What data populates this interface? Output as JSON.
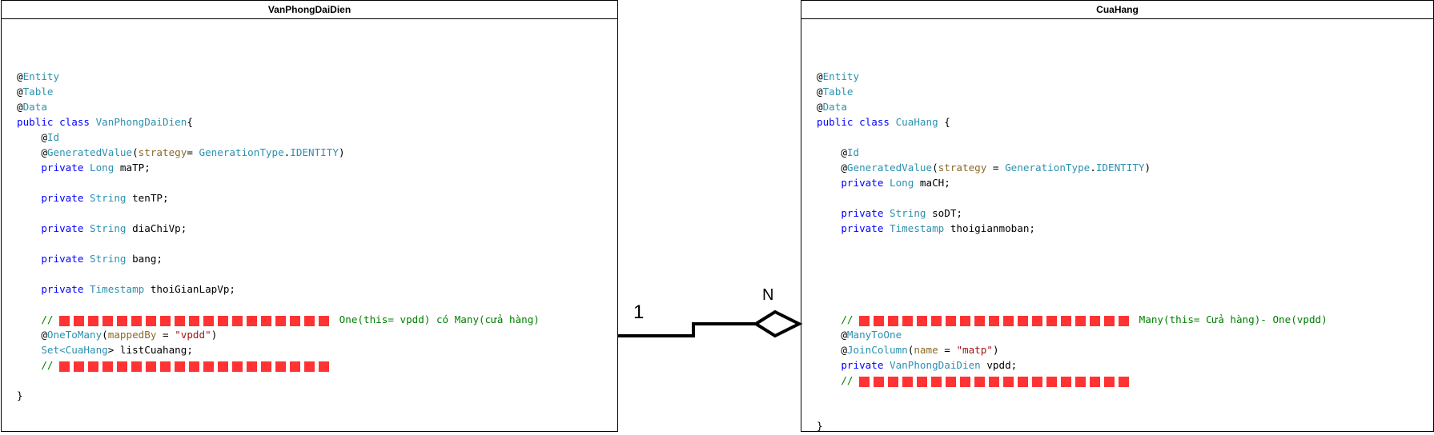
{
  "diagram": {
    "left_class": {
      "title": "VanPhongDaiDien",
      "code": [
        [],
        [
          {
            "t": "@",
            "c": "at"
          },
          {
            "t": "Entity",
            "c": "ann"
          }
        ],
        [
          {
            "t": "@",
            "c": "at"
          },
          {
            "t": "Table",
            "c": "ann"
          }
        ],
        [
          {
            "t": "@",
            "c": "at"
          },
          {
            "t": "Data",
            "c": "ann"
          }
        ],
        [
          {
            "t": "public class ",
            "c": "kw"
          },
          {
            "t": "VanPhongDaiDien",
            "c": "type"
          },
          {
            "t": "{",
            "c": "plain"
          }
        ],
        [
          {
            "t": "    @",
            "c": "at"
          },
          {
            "t": "Id",
            "c": "ann"
          }
        ],
        [
          {
            "t": "    @",
            "c": "at"
          },
          {
            "t": "GeneratedValue",
            "c": "ann"
          },
          {
            "t": "(",
            "c": "plain"
          },
          {
            "t": "strategy",
            "c": "param"
          },
          {
            "t": "= ",
            "c": "plain"
          },
          {
            "t": "GenerationType",
            "c": "type"
          },
          {
            "t": ".",
            "c": "plain"
          },
          {
            "t": "IDENTITY",
            "c": "ann"
          },
          {
            "t": ")",
            "c": "plain"
          }
        ],
        [
          {
            "t": "    private ",
            "c": "kw"
          },
          {
            "t": "Long ",
            "c": "type"
          },
          {
            "t": "maTP;",
            "c": "plain"
          }
        ],
        [],
        [
          {
            "t": "    private ",
            "c": "kw"
          },
          {
            "t": "String ",
            "c": "type"
          },
          {
            "t": "tenTP;",
            "c": "plain"
          }
        ],
        [],
        [
          {
            "t": "    private ",
            "c": "kw"
          },
          {
            "t": "String ",
            "c": "type"
          },
          {
            "t": "diaChiVp;",
            "c": "plain"
          }
        ],
        [],
        [
          {
            "t": "    private ",
            "c": "kw"
          },
          {
            "t": "String ",
            "c": "type"
          },
          {
            "t": "bang;",
            "c": "plain"
          }
        ],
        [],
        [
          {
            "t": "    private ",
            "c": "kw"
          },
          {
            "t": "Timestamp ",
            "c": "type"
          },
          {
            "t": "thoiGianLapVp;",
            "c": "plain"
          }
        ],
        [],
        [
          {
            "t": "    // ",
            "c": "cmt"
          },
          {
            "bar": 19
          },
          {
            "t": " One(this= vpdd) có Many(cửa hàng)",
            "c": "cmt"
          }
        ],
        [
          {
            "t": "    @",
            "c": "at"
          },
          {
            "t": "OneToMany",
            "c": "ann"
          },
          {
            "t": "(",
            "c": "plain"
          },
          {
            "t": "mappedBy",
            "c": "param"
          },
          {
            "t": " = ",
            "c": "plain"
          },
          {
            "t": "\"vpdd\"",
            "c": "str"
          },
          {
            "t": ")",
            "c": "plain"
          }
        ],
        [
          {
            "t": "    Set<",
            "c": "type"
          },
          {
            "t": "CuaHang",
            "c": "type"
          },
          {
            "t": "> ",
            "c": "plain"
          },
          {
            "t": "listCuahang;",
            "c": "plain"
          }
        ],
        [
          {
            "t": "    // ",
            "c": "cmt"
          },
          {
            "bar": 19
          }
        ],
        [],
        [
          {
            "t": "}",
            "c": "plain"
          }
        ]
      ]
    },
    "right_class": {
      "title": "CuaHang",
      "code": [
        [],
        [
          {
            "t": "@",
            "c": "at"
          },
          {
            "t": "Entity",
            "c": "ann"
          }
        ],
        [
          {
            "t": "@",
            "c": "at"
          },
          {
            "t": "Table",
            "c": "ann"
          }
        ],
        [
          {
            "t": "@",
            "c": "at"
          },
          {
            "t": "Data",
            "c": "ann"
          }
        ],
        [
          {
            "t": "public class ",
            "c": "kw"
          },
          {
            "t": "CuaHang",
            "c": "type"
          },
          {
            "t": " {",
            "c": "plain"
          }
        ],
        [],
        [
          {
            "t": "    @",
            "c": "at"
          },
          {
            "t": "Id",
            "c": "ann"
          }
        ],
        [
          {
            "t": "    @",
            "c": "at"
          },
          {
            "t": "GeneratedValue",
            "c": "ann"
          },
          {
            "t": "(",
            "c": "plain"
          },
          {
            "t": "strategy",
            "c": "param"
          },
          {
            "t": " = ",
            "c": "plain"
          },
          {
            "t": "GenerationType",
            "c": "type"
          },
          {
            "t": ".",
            "c": "plain"
          },
          {
            "t": "IDENTITY",
            "c": "ann"
          },
          {
            "t": ")",
            "c": "plain"
          }
        ],
        [
          {
            "t": "    private ",
            "c": "kw"
          },
          {
            "t": "Long ",
            "c": "type"
          },
          {
            "t": "maCH;",
            "c": "plain"
          }
        ],
        [],
        [
          {
            "t": "    private ",
            "c": "kw"
          },
          {
            "t": "String ",
            "c": "type"
          },
          {
            "t": "soDT;",
            "c": "plain"
          }
        ],
        [
          {
            "t": "    private ",
            "c": "kw"
          },
          {
            "t": "Timestamp ",
            "c": "type"
          },
          {
            "t": "thoigianmoban;",
            "c": "plain"
          }
        ],
        [],
        [],
        [],
        [],
        [],
        [
          {
            "t": "    // ",
            "c": "cmt"
          },
          {
            "bar": 19
          },
          {
            "t": " Many(this= Cửa hàng)- One(vpdd)",
            "c": "cmt"
          }
        ],
        [
          {
            "t": "    @",
            "c": "at"
          },
          {
            "t": "ManyToOne",
            "c": "ann"
          }
        ],
        [
          {
            "t": "    @",
            "c": "at"
          },
          {
            "t": "JoinColumn",
            "c": "ann"
          },
          {
            "t": "(",
            "c": "plain"
          },
          {
            "t": "name",
            "c": "param"
          },
          {
            "t": " = ",
            "c": "plain"
          },
          {
            "t": "\"matp\"",
            "c": "str"
          },
          {
            "t": ")",
            "c": "plain"
          }
        ],
        [
          {
            "t": "    private ",
            "c": "kw"
          },
          {
            "t": "VanPhongDaiDien ",
            "c": "type"
          },
          {
            "t": "vpdd;",
            "c": "plain"
          }
        ],
        [
          {
            "t": "    // ",
            "c": "cmt"
          },
          {
            "bar": 19
          }
        ],
        [],
        [],
        [
          {
            "t": "}",
            "c": "plain"
          }
        ]
      ]
    },
    "association": {
      "left_multiplicity": "1",
      "right_multiplicity": "N",
      "right_end": "open-diamond"
    }
  }
}
